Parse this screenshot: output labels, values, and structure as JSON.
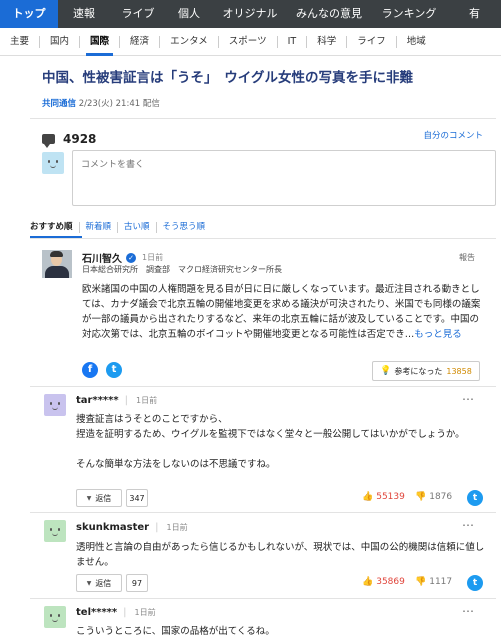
{
  "top_nav": {
    "tabs": [
      {
        "label": "トップ"
      },
      {
        "label": "速報"
      },
      {
        "label": "ライブ"
      },
      {
        "label": "個人"
      },
      {
        "label": "オリジナル"
      },
      {
        "label": "みんなの意見"
      },
      {
        "label": "ランキング"
      },
      {
        "label": "有"
      }
    ],
    "active_color": "#1b6cd6",
    "bg_color": "#3b4043"
  },
  "sub_nav": {
    "categories": [
      {
        "label": "主要"
      },
      {
        "label": "国内"
      },
      {
        "label": "国際"
      },
      {
        "label": "経済"
      },
      {
        "label": "エンタメ"
      },
      {
        "label": "スポーツ"
      },
      {
        "label": "IT"
      },
      {
        "label": "科学"
      },
      {
        "label": "ライフ"
      },
      {
        "label": "地域"
      }
    ],
    "active": "国際"
  },
  "article": {
    "headline": "中国、性被害証言は「うそ」　ウイグル女性の写真を手に非難",
    "source": "共同通信",
    "date": "2/23(火) 21:41 配信",
    "headline_color": "#273d7b"
  },
  "comments_section": {
    "count": "4928",
    "my_comments_link": "自分のコメント",
    "input_placeholder": "コメントを書く",
    "sort_options": [
      "おすすめ順",
      "新着順",
      "古い順",
      "そう思う順"
    ],
    "expert": {
      "name": "石川智久",
      "time": "1日前",
      "title": "日本総合研究所　調査部　マクロ経済研究センター所長",
      "report_label": "報告",
      "body": "欧米諸国の中国の人権問題を見る目が日に日に厳しくなっています。最近注目される動きとしては、カナダ議会で北京五輪の開催地変更を求める議決が可決されたり、米国でも同様の議案が一部の議員から出されたりするなど、来年の北京五輪に話が波及していることです。中国の対応次第では、北京五輪のボイコットや開催地変更となる可能性は否定でき…",
      "more_label": "もっと見る",
      "helpful_label": "参考になった",
      "helpful_count": "13858",
      "facebook_icon": "f",
      "twitter_icon": "t"
    },
    "comments": [
      {
        "user": "tar*****",
        "time": "1日前",
        "body": "捜査証言はうそとのことですから、\n捏造を証明するため、ウイグルを監視下ではなく堂々と一般公開してはいかがでしょうか。\n\nそんな簡単な方法をしないのは不思議ですね。",
        "reply_label": "返信",
        "reply_count": "347",
        "good": "55139",
        "bad": "1876",
        "avatar_color": "#c9c3ee"
      },
      {
        "user": "skunkmaster",
        "time": "1日前",
        "body": "透明性と言論の自由があったら信じるかもしれないが、現状では、中国の公的機関は信頼に値しません。",
        "reply_label": "返信",
        "reply_count": "97",
        "good": "35869",
        "bad": "1117",
        "avatar_color": "#bde4bf"
      },
      {
        "user": "tel*****",
        "time": "1日前",
        "body": "こういうところに、国家の品格が出てくるね。",
        "avatar_color": "#bde4bf"
      }
    ],
    "icons": {
      "more": "⋯",
      "thumbs_up": "thumbs-up-icon",
      "thumbs_down": "thumbs-down-icon",
      "bulb": "lightbulb-icon",
      "reply_caret": "▼"
    }
  }
}
